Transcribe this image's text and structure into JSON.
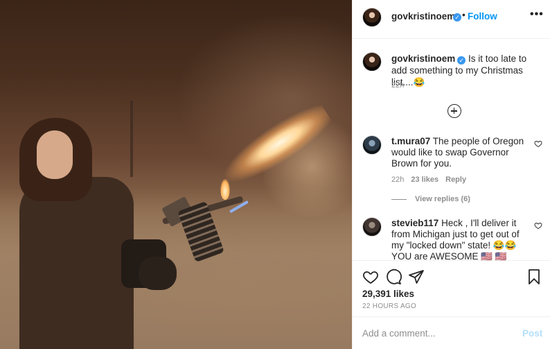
{
  "post_image": {
    "description_icon": "flamethrower-photo"
  },
  "header": {
    "username": "govkristinoem",
    "verified_icon": "verified-badge-icon",
    "separator": "•",
    "follow_label": "Follow",
    "more_icon": "•••"
  },
  "caption": {
    "username": "govkristinoem",
    "text": "Is it too late to add something to my Christmas list....😂",
    "time": "22h"
  },
  "comments": [
    {
      "username": "t.mura07",
      "text": "The people of Oregon would like to swap Governor Brown for you.",
      "time": "22h",
      "likes": "23 likes",
      "reply": "Reply",
      "view_replies": "View replies (6)"
    },
    {
      "username": "stevieb117",
      "text": "Heck , I'll deliver it from Michigan just to get out of my \"locked down\" state! 😂😂 YOU are AWESOME 🇺🇸 🇺🇸"
    }
  ],
  "actions": {
    "likes": "29,391 likes",
    "timestamp": "22 HOURS AGO"
  },
  "add_comment": {
    "placeholder": "Add a comment...",
    "post_label": "Post"
  },
  "colors": {
    "link": "#0095f6",
    "verified": "#3897f0",
    "muted": "#8e8e8e",
    "post_disabled": "#b2dffc"
  }
}
